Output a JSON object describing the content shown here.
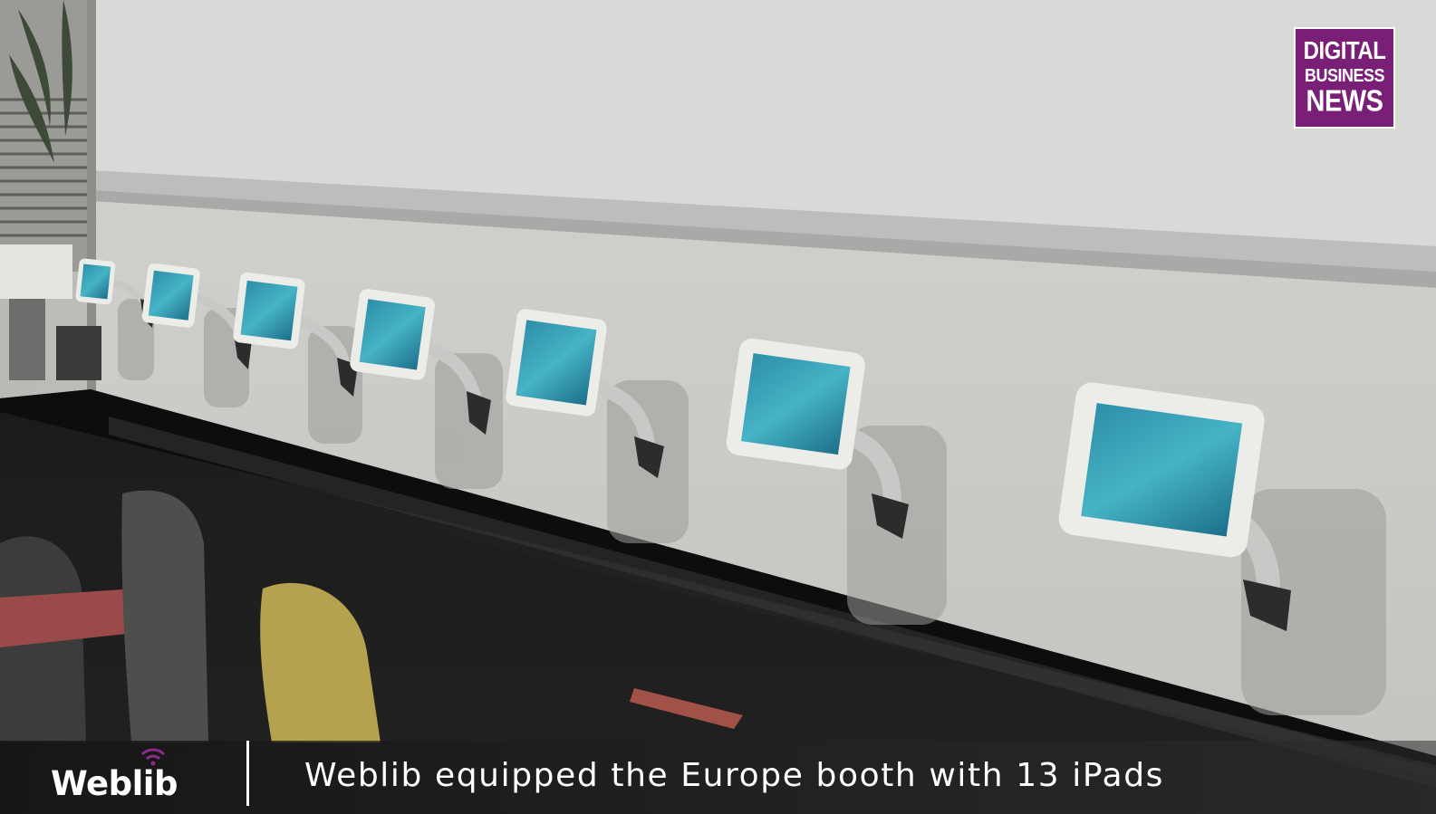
{
  "watermark": {
    "line1": "DIGITAL",
    "line2": "BUSINESS",
    "line3": "NEWS",
    "background_color": "#7a1f78"
  },
  "lower_third": {
    "brand": "Weblib",
    "brand_icon": "wifi-icon",
    "brand_icon_color": "#8a2b86",
    "caption": "Weblib equipped the Europe booth with 13 iPads"
  }
}
